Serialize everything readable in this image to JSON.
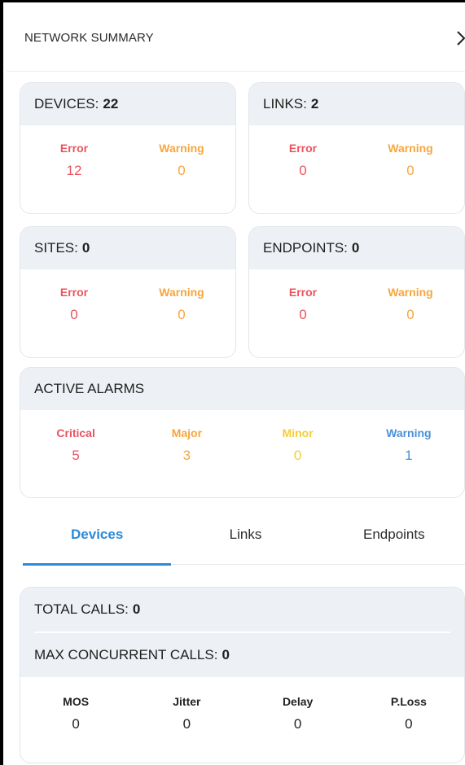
{
  "header": {
    "title": "NETWORK SUMMARY",
    "chevron_icon": "chevron-right-icon"
  },
  "summary_cards": [
    {
      "label": "DEVICES:",
      "count": "22",
      "stats": [
        {
          "label": "Error",
          "value": "12"
        },
        {
          "label": "Warning",
          "value": "0"
        }
      ]
    },
    {
      "label": "LINKS:",
      "count": "2",
      "stats": [
        {
          "label": "Error",
          "value": "0"
        },
        {
          "label": "Warning",
          "value": "0"
        }
      ]
    },
    {
      "label": "SITES:",
      "count": "0",
      "stats": [
        {
          "label": "Error",
          "value": "0"
        },
        {
          "label": "Warning",
          "value": "0"
        }
      ]
    },
    {
      "label": "ENDPOINTS:",
      "count": "0",
      "stats": [
        {
          "label": "Error",
          "value": "0"
        },
        {
          "label": "Warning",
          "value": "0"
        }
      ]
    }
  ],
  "alarms": {
    "title": "ACTIVE ALARMS",
    "items": [
      {
        "label": "Critical",
        "value": "5"
      },
      {
        "label": "Major",
        "value": "3"
      },
      {
        "label": "Minor",
        "value": "0"
      },
      {
        "label": "Warning",
        "value": "1"
      }
    ]
  },
  "tabs": [
    {
      "label": "Devices",
      "active": true
    },
    {
      "label": "Links",
      "active": false
    },
    {
      "label": "Endpoints",
      "active": false
    }
  ],
  "calls": {
    "total_label": "TOTAL CALLS:",
    "total_value": "0",
    "max_label": "MAX CONCURRENT CALLS:",
    "max_value": "0",
    "metrics": [
      {
        "label": "MOS",
        "value": "0"
      },
      {
        "label": "Jitter",
        "value": "0"
      },
      {
        "label": "Delay",
        "value": "0"
      },
      {
        "label": "P.Loss",
        "value": "0"
      }
    ]
  },
  "colors": {
    "error": "#e8545f",
    "warning": "#f7a63d",
    "minor": "#f5cd36",
    "info": "#4a90d9",
    "accent": "#2c8ad8",
    "card_header_bg": "#edf0f4"
  }
}
